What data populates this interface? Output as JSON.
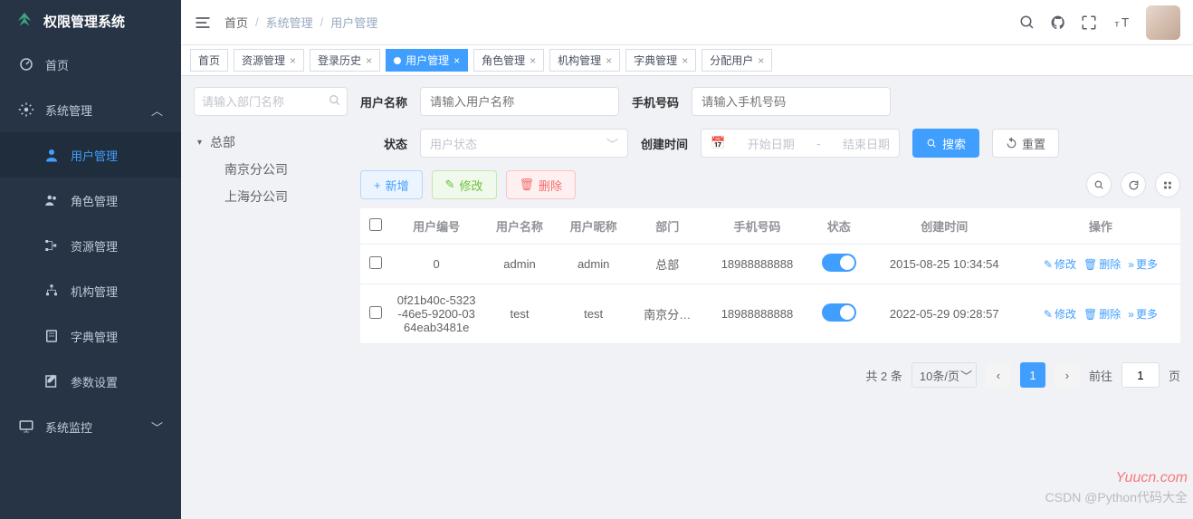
{
  "app": {
    "title": "权限管理系统"
  },
  "sidebar": {
    "items": [
      {
        "label": "首页"
      },
      {
        "label": "系统管理"
      },
      {
        "label": "用户管理"
      },
      {
        "label": "角色管理"
      },
      {
        "label": "资源管理"
      },
      {
        "label": "机构管理"
      },
      {
        "label": "字典管理"
      },
      {
        "label": "参数设置"
      },
      {
        "label": "系统监控"
      }
    ]
  },
  "breadcrumb": {
    "home": "首页",
    "sys": "系统管理",
    "page": "用户管理"
  },
  "tabs": [
    {
      "label": "首页"
    },
    {
      "label": "资源管理"
    },
    {
      "label": "登录历史"
    },
    {
      "label": "用户管理",
      "active": true
    },
    {
      "label": "角色管理"
    },
    {
      "label": "机构管理"
    },
    {
      "label": "字典管理"
    },
    {
      "label": "分配用户"
    }
  ],
  "deptSearch": {
    "placeholder": "请输入部门名称"
  },
  "tree": {
    "root": "总部",
    "children": [
      {
        "label": "南京分公司"
      },
      {
        "label": "上海分公司"
      }
    ]
  },
  "form": {
    "username_label": "用户名称",
    "username_placeholder": "请输入用户名称",
    "phone_label": "手机号码",
    "phone_placeholder": "请输入手机号码",
    "status_label": "状态",
    "status_placeholder": "用户状态",
    "ctime_label": "创建时间",
    "date_start": "开始日期",
    "date_sep": "-",
    "date_end": "结束日期",
    "search_btn": "搜索",
    "reset_btn": "重置"
  },
  "actions": {
    "add": "新增",
    "edit": "修改",
    "del": "删除"
  },
  "table": {
    "cols": {
      "id": "用户编号",
      "name": "用户名称",
      "nick": "用户昵称",
      "dept": "部门",
      "phone": "手机号码",
      "status": "状态",
      "ctime": "创建时间",
      "ops": "操作"
    },
    "rows": [
      {
        "id": "0",
        "name": "admin",
        "nick": "admin",
        "dept": "总部",
        "phone": "18988888888",
        "ctime": "2015-08-25 10:34:54"
      },
      {
        "id": "0f21b40c-5323-46e5-9200-0364eab3481e",
        "name": "test",
        "nick": "test",
        "dept": "南京分…",
        "phone": "18988888888",
        "ctime": "2022-05-29 09:28:57"
      }
    ],
    "row_actions": {
      "edit": "修改",
      "del": "删除",
      "more": "更多"
    }
  },
  "pager": {
    "total": "共 2 条",
    "size": "10条/页",
    "page": "1",
    "goto": "前往",
    "goto_val": "1",
    "goto_suffix": "页"
  },
  "watermark1": "Yuucn.com",
  "watermark2": "CSDN @Python代码大全"
}
